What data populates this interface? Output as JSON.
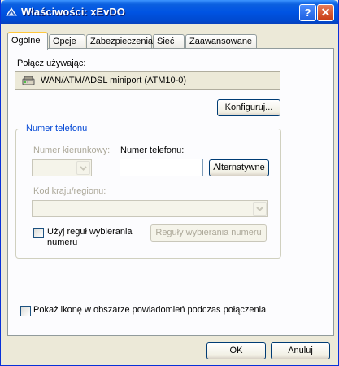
{
  "window": {
    "title": "Właściwości: xEvDO",
    "help_label": "?",
    "close_label": "✕"
  },
  "tabs": [
    {
      "label": "Ogólne",
      "active": true
    },
    {
      "label": "Opcje"
    },
    {
      "label": "Zabezpieczenia"
    },
    {
      "label": "Sieć"
    },
    {
      "label": "Zaawansowane"
    }
  ],
  "general": {
    "connect_using_label": "Połącz używając:",
    "device_name": "WAN/ATM/ADSL miniport (ATM10-0)",
    "configure_button": "Konfiguruj...",
    "phone_group_title": "Numer telefonu",
    "area_code_label": "Numer kierunkowy:",
    "area_code_value": "",
    "phone_number_label": "Numer telefonu:",
    "phone_number_value": "",
    "alternates_button": "Alternatywne",
    "country_code_label": "Kod kraju/regionu:",
    "country_code_value": "",
    "use_dialing_rules_label": "Użyj reguł wybierania numeru",
    "use_dialing_rules_checked": false,
    "dialing_rules_button": "Reguły wybierania numeru",
    "show_icon_label": "Pokaż ikonę w obszarze powiadomień podczas połączenia",
    "show_icon_checked": false
  },
  "footer": {
    "ok_button": "OK",
    "cancel_button": "Anuluj"
  },
  "colors": {
    "titlebar": "#0054e3",
    "group_title": "#0046d5",
    "dialog_bg": "#ece9d8"
  }
}
